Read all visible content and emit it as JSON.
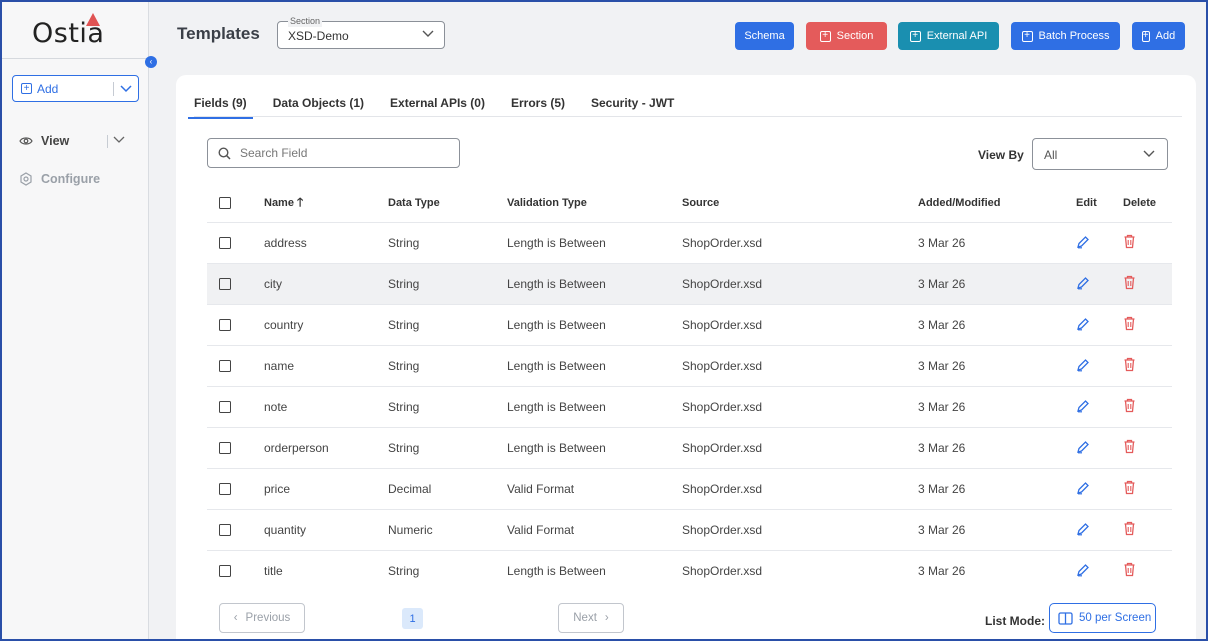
{
  "app": {
    "logo": "Ostia",
    "logo_accent": "#e05353"
  },
  "sidebar": {
    "add_label": "Add",
    "view_label": "View",
    "configure_label": "Configure"
  },
  "header": {
    "title": "Templates",
    "section_legend": "Section",
    "section_value": "XSD-Demo",
    "buttons": [
      {
        "label": "Schema",
        "color": "#2f6fe4",
        "icon": "none"
      },
      {
        "label": "Section",
        "color": "#e45b5b",
        "icon": "plus-box-icon"
      },
      {
        "label": "External API",
        "color": "#1a8fb0",
        "icon": "plus-box-icon"
      },
      {
        "label": "Batch Process",
        "color": "#2f6fe4",
        "icon": "plus-box-icon"
      },
      {
        "label": "Add",
        "color": "#2f6fe4",
        "icon": "plus-box-icon"
      }
    ]
  },
  "tabs": [
    "Fields (9)",
    "Data Objects (1)",
    "External APIs (0)",
    "Errors (5)",
    "Security - JWT"
  ],
  "active_tab": 0,
  "search": {
    "placeholder": "Search Field"
  },
  "view_by": {
    "label": "View By",
    "value": "All"
  },
  "table": {
    "columns": {
      "name": "Name",
      "data_type": "Data Type",
      "validation_type": "Validation Type",
      "source": "Source",
      "added_modified": "Added/Modified",
      "edit": "Edit",
      "delete": "Delete"
    },
    "sort": {
      "column": "name",
      "direction": "ascending"
    },
    "rows": [
      {
        "name": "address",
        "data_type": "String",
        "validation_type": "Length is Between",
        "source": "ShopOrder.xsd",
        "added_modified": "3 Mar 26"
      },
      {
        "name": "city",
        "data_type": "String",
        "validation_type": "Length is Between",
        "source": "ShopOrder.xsd",
        "added_modified": "3 Mar 26",
        "highlighted": true
      },
      {
        "name": "country",
        "data_type": "String",
        "validation_type": "Length is Between",
        "source": "ShopOrder.xsd",
        "added_modified": "3 Mar 26"
      },
      {
        "name": "name",
        "data_type": "String",
        "validation_type": "Length is Between",
        "source": "ShopOrder.xsd",
        "added_modified": "3 Mar 26"
      },
      {
        "name": "note",
        "data_type": "String",
        "validation_type": "Length is Between",
        "source": "ShopOrder.xsd",
        "added_modified": "3 Mar 26"
      },
      {
        "name": "orderperson",
        "data_type": "String",
        "validation_type": "Length is Between",
        "source": "ShopOrder.xsd",
        "added_modified": "3 Mar 26"
      },
      {
        "name": "price",
        "data_type": "Decimal",
        "validation_type": "Valid Format",
        "source": "ShopOrder.xsd",
        "added_modified": "3 Mar 26"
      },
      {
        "name": "quantity",
        "data_type": "Numeric",
        "validation_type": "Valid Format",
        "source": "ShopOrder.xsd",
        "added_modified": "3 Mar 26"
      },
      {
        "name": "title",
        "data_type": "String",
        "validation_type": "Length is Between",
        "source": "ShopOrder.xsd",
        "added_modified": "3 Mar 26"
      }
    ]
  },
  "pagination": {
    "previous_label": "Previous",
    "current_page": "1",
    "next_label": "Next",
    "list_mode_label": "List Mode:",
    "per_screen_label": "50 per Screen"
  },
  "colors": {
    "accent": "#2f6fe4",
    "danger": "#e45b5b",
    "teal": "#1a8fb0"
  }
}
